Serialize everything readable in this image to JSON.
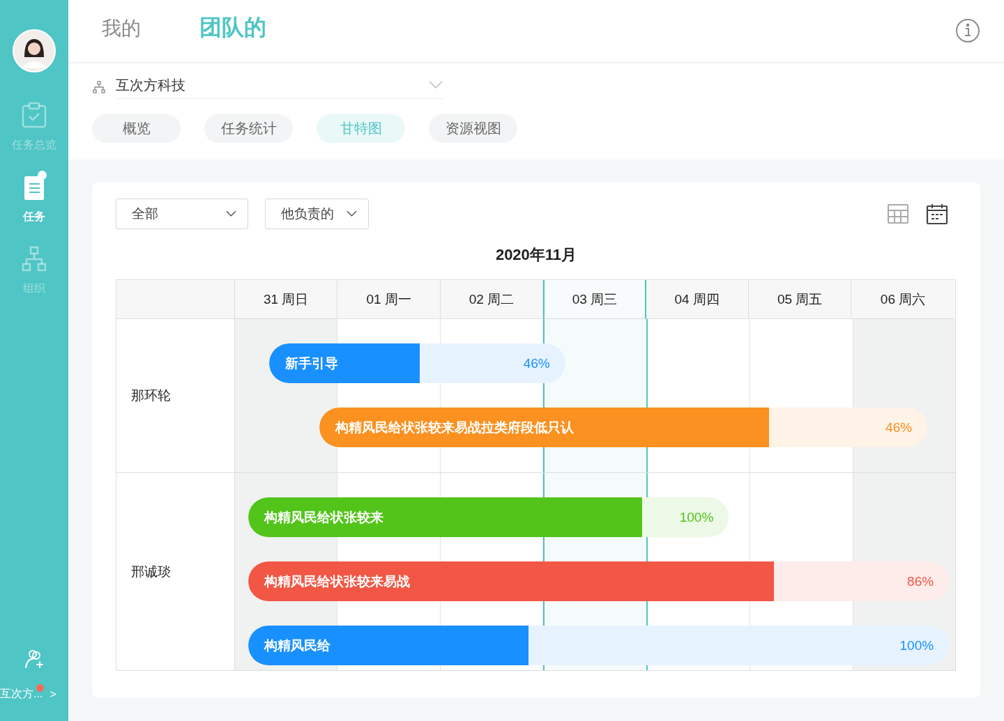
{
  "sidebar": {
    "items": [
      {
        "label": "任务总览",
        "kind": "clipboard",
        "selected": false
      },
      {
        "label": "任务",
        "kind": "list",
        "selected": true,
        "notice": true
      },
      {
        "label": "组织",
        "kind": "org",
        "selected": false
      }
    ],
    "footer": {
      "org": "互次方...",
      "notice": true,
      "arrow": ">"
    }
  },
  "header": {
    "tabs": [
      {
        "label": "我的",
        "selected": false
      },
      {
        "label": "团队的",
        "selected": true
      }
    ]
  },
  "org_select": {
    "value": "互次方科技"
  },
  "views": [
    {
      "label": "概览",
      "selected": false
    },
    {
      "label": "任务统计",
      "selected": false
    },
    {
      "label": "甘特图",
      "selected": true
    },
    {
      "label": "资源视图",
      "selected": false
    }
  ],
  "filters": [
    {
      "value": "全部"
    },
    {
      "value": "他负责的"
    }
  ],
  "display_modes": [
    {
      "kind": "table",
      "selected": false
    },
    {
      "kind": "calendar",
      "selected": true
    }
  ],
  "gantt": {
    "month": "2020年11月",
    "days": [
      {
        "label": "31 周日",
        "weekend": true,
        "today": false
      },
      {
        "label": "01 周一",
        "weekend": false,
        "today": false
      },
      {
        "label": "02 周二",
        "weekend": false,
        "today": false
      },
      {
        "label": "03 周三",
        "weekend": false,
        "today": true
      },
      {
        "label": "04 周四",
        "weekend": false,
        "today": false
      },
      {
        "label": "05 周五",
        "weekend": false,
        "today": false
      },
      {
        "label": "06 周六",
        "weekend": true,
        "today": false
      }
    ],
    "people": [
      {
        "name": "那环轮",
        "tasks": [
          {
            "title": "新手引导",
            "percent": "46%",
            "color": "#1890ff",
            "level": 0.51
          },
          {
            "title": "构精风民给状张较来易战拉类府段低只认",
            "percent": "46%",
            "color": "#fa9120",
            "level": 0.74
          }
        ]
      },
      {
        "name": "邢诚琰",
        "tasks": [
          {
            "title": "构精风民给状张较来",
            "percent": "100%",
            "color": "#52c41a",
            "level": 0.82
          },
          {
            "title": "构精风民给状张较来易战",
            "percent": "86%",
            "color": "#f25644",
            "level": 0.75
          },
          {
            "title": "构精风民给",
            "percent": "100%",
            "color": "#1890ff",
            "level": 0.4
          }
        ]
      }
    ]
  }
}
